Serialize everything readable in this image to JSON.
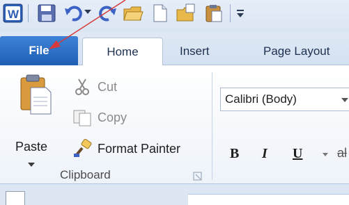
{
  "quick_access": {
    "icons": [
      "word-logo-icon",
      "save-icon",
      "undo-icon",
      "redo-icon",
      "open-folder-icon",
      "new-document-icon",
      "recent-folder-icon",
      "paste-icon",
      "customize-toolbar-icon"
    ],
    "logo_letter": "W"
  },
  "tabs": [
    {
      "label": "File"
    },
    {
      "label": "Home"
    },
    {
      "label": "Insert"
    },
    {
      "label": "Page Layout"
    }
  ],
  "clipboard": {
    "paste_label": "Paste",
    "cut_label": "Cut",
    "copy_label": "Copy",
    "format_painter_label": "Format Painter",
    "group_label": "Clipboard"
  },
  "font": {
    "font_name": "Calibri (Body)",
    "bold": "B",
    "italic": "I",
    "underline": "U",
    "strikethrough_partial": "al"
  },
  "annotation": {
    "color": "#d63a3a"
  }
}
